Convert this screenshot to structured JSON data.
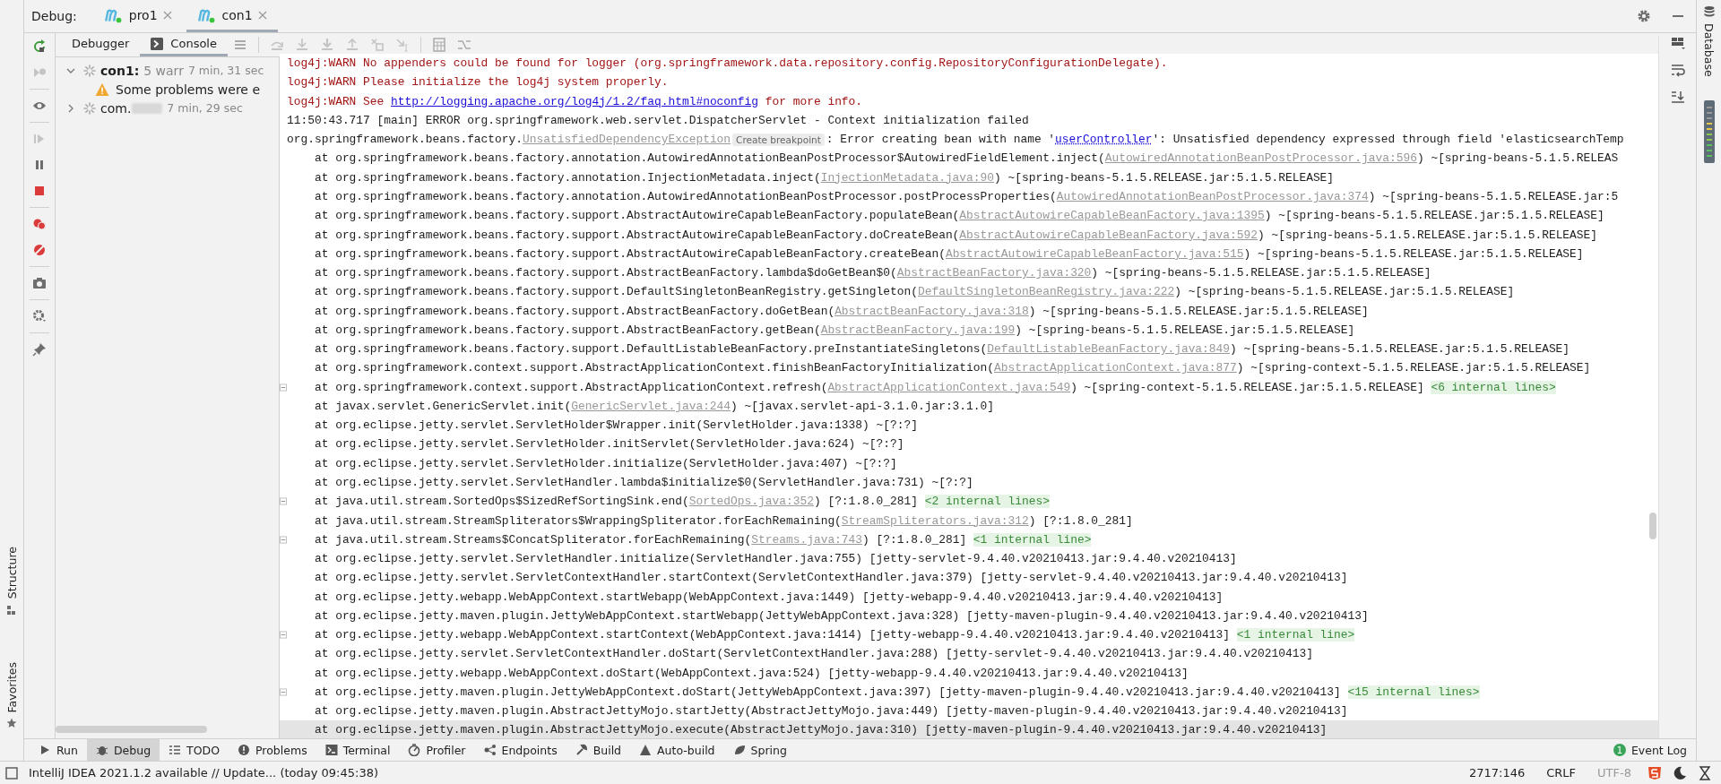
{
  "debug_bar": {
    "label": "Debug:",
    "tabs": [
      {
        "label": "pro1",
        "selected": false
      },
      {
        "label": "con1",
        "selected": true
      }
    ]
  },
  "view_tabs": [
    {
      "label": "Debugger",
      "selected": false
    },
    {
      "label": "Console",
      "selected": true
    }
  ],
  "tree": [
    {
      "label": "con1:",
      "warnings": "5 warr",
      "time": "7 min, 31 sec",
      "expanded": true,
      "children": [
        {
          "label": "Some problems were e"
        }
      ]
    },
    {
      "label": "com.",
      "time": "7 min, 29 sec",
      "expanded": false
    }
  ],
  "console": [
    {
      "kind": "warn",
      "fold_marker": false,
      "current": false,
      "parts": [
        {
          "kind": "text",
          "text": "log4j:WARN No appenders could be found for logger (org.springframework.data.repository.config.RepositoryConfigurationDelegate)."
        }
      ]
    },
    {
      "kind": "warn",
      "fold_marker": false,
      "current": false,
      "parts": [
        {
          "kind": "text",
          "text": "log4j:WARN Please initialize the log4j system properly."
        }
      ]
    },
    {
      "kind": "warn",
      "fold_marker": false,
      "current": false,
      "parts": [
        {
          "kind": "text",
          "text": "log4j:WARN See "
        },
        {
          "kind": "url",
          "text": "http://logging.apache.org/log4j/1.2/faq.html#noconfig"
        },
        {
          "kind": "text",
          "text": " for more info."
        }
      ]
    },
    {
      "kind": "message",
      "fold_marker": false,
      "current": false,
      "parts": [
        {
          "kind": "text",
          "text": "11:50:43.717 [main] ERROR org.springframework.web.servlet.DispatcherServlet - Context initialization failed"
        }
      ]
    },
    {
      "kind": "message",
      "fold_marker": false,
      "current": false,
      "parts": [
        {
          "kind": "text",
          "text": "org.springframework.beans.factory."
        },
        {
          "kind": "link",
          "text": "UnsatisfiedDependencyException"
        },
        {
          "kind": "hint",
          "text": "Create breakpoint"
        },
        {
          "kind": "text",
          "text": ": Error creating bean with name '"
        },
        {
          "kind": "ref",
          "text": "userController"
        },
        {
          "kind": "text",
          "text": "': Unsatisfied dependency expressed through field 'elasticsearchTemp"
        }
      ]
    },
    {
      "kind": "frame",
      "fold_marker": false,
      "current": false,
      "parts": [
        {
          "kind": "text",
          "text": "at org.springframework.beans.factory.annotation.AutowiredAnnotationBeanPostProcessor$AutowiredFieldElement.inject("
        },
        {
          "kind": "link",
          "text": "AutowiredAnnotationBeanPostProcessor.java:596"
        },
        {
          "kind": "text",
          "text": ") ~[spring-beans-5.1.5.RELEAS"
        }
      ]
    },
    {
      "kind": "frame",
      "fold_marker": false,
      "current": false,
      "parts": [
        {
          "kind": "text",
          "text": "at org.springframework.beans.factory.annotation.InjectionMetadata.inject("
        },
        {
          "kind": "link",
          "text": "InjectionMetadata.java:90"
        },
        {
          "kind": "text",
          "text": ") ~[spring-beans-5.1.5.RELEASE.jar:5.1.5.RELEASE]"
        }
      ]
    },
    {
      "kind": "frame",
      "fold_marker": false,
      "current": false,
      "parts": [
        {
          "kind": "text",
          "text": "at org.springframework.beans.factory.annotation.AutowiredAnnotationBeanPostProcessor.postProcessProperties("
        },
        {
          "kind": "link",
          "text": "AutowiredAnnotationBeanPostProcessor.java:374"
        },
        {
          "kind": "text",
          "text": ") ~[spring-beans-5.1.5.RELEASE.jar:5"
        }
      ]
    },
    {
      "kind": "frame",
      "fold_marker": false,
      "current": false,
      "parts": [
        {
          "kind": "text",
          "text": "at org.springframework.beans.factory.support.AbstractAutowireCapableBeanFactory.populateBean("
        },
        {
          "kind": "link",
          "text": "AbstractAutowireCapableBeanFactory.java:1395"
        },
        {
          "kind": "text",
          "text": ") ~[spring-beans-5.1.5.RELEASE.jar:5.1.5.RELEASE]"
        }
      ]
    },
    {
      "kind": "frame",
      "fold_marker": false,
      "current": false,
      "parts": [
        {
          "kind": "text",
          "text": "at org.springframework.beans.factory.support.AbstractAutowireCapableBeanFactory.doCreateBean("
        },
        {
          "kind": "link",
          "text": "AbstractAutowireCapableBeanFactory.java:592"
        },
        {
          "kind": "text",
          "text": ") ~[spring-beans-5.1.5.RELEASE.jar:5.1.5.RELEASE]"
        }
      ]
    },
    {
      "kind": "frame",
      "fold_marker": false,
      "current": false,
      "parts": [
        {
          "kind": "text",
          "text": "at org.springframework.beans.factory.support.AbstractAutowireCapableBeanFactory.createBean("
        },
        {
          "kind": "link",
          "text": "AbstractAutowireCapableBeanFactory.java:515"
        },
        {
          "kind": "text",
          "text": ") ~[spring-beans-5.1.5.RELEASE.jar:5.1.5.RELEASE]"
        }
      ]
    },
    {
      "kind": "frame",
      "fold_marker": false,
      "current": false,
      "parts": [
        {
          "kind": "text",
          "text": "at org.springframework.beans.factory.support.AbstractBeanFactory.lambda$doGetBean$0("
        },
        {
          "kind": "link",
          "text": "AbstractBeanFactory.java:320"
        },
        {
          "kind": "text",
          "text": ") ~[spring-beans-5.1.5.RELEASE.jar:5.1.5.RELEASE]"
        }
      ]
    },
    {
      "kind": "frame",
      "fold_marker": false,
      "current": false,
      "parts": [
        {
          "kind": "text",
          "text": "at org.springframework.beans.factory.support.DefaultSingletonBeanRegistry.getSingleton("
        },
        {
          "kind": "link",
          "text": "DefaultSingletonBeanRegistry.java:222"
        },
        {
          "kind": "text",
          "text": ") ~[spring-beans-5.1.5.RELEASE.jar:5.1.5.RELEASE]"
        }
      ]
    },
    {
      "kind": "frame",
      "fold_marker": false,
      "current": false,
      "parts": [
        {
          "kind": "text",
          "text": "at org.springframework.beans.factory.support.AbstractBeanFactory.doGetBean("
        },
        {
          "kind": "link",
          "text": "AbstractBeanFactory.java:318"
        },
        {
          "kind": "text",
          "text": ") ~[spring-beans-5.1.5.RELEASE.jar:5.1.5.RELEASE]"
        }
      ]
    },
    {
      "kind": "frame",
      "fold_marker": false,
      "current": false,
      "parts": [
        {
          "kind": "text",
          "text": "at org.springframework.beans.factory.support.AbstractBeanFactory.getBean("
        },
        {
          "kind": "link",
          "text": "AbstractBeanFactory.java:199"
        },
        {
          "kind": "text",
          "text": ") ~[spring-beans-5.1.5.RELEASE.jar:5.1.5.RELEASE]"
        }
      ]
    },
    {
      "kind": "frame",
      "fold_marker": false,
      "current": false,
      "parts": [
        {
          "kind": "text",
          "text": "at org.springframework.beans.factory.support.DefaultListableBeanFactory.preInstantiateSingletons("
        },
        {
          "kind": "link",
          "text": "DefaultListableBeanFactory.java:849"
        },
        {
          "kind": "text",
          "text": ") ~[spring-beans-5.1.5.RELEASE.jar:5.1.5.RELEASE]"
        }
      ]
    },
    {
      "kind": "frame",
      "fold_marker": false,
      "current": false,
      "parts": [
        {
          "kind": "text",
          "text": "at org.springframework.context.support.AbstractApplicationContext.finishBeanFactoryInitialization("
        },
        {
          "kind": "link",
          "text": "AbstractApplicationContext.java:877"
        },
        {
          "kind": "text",
          "text": ") ~[spring-context-5.1.5.RELEASE.jar:5.1.5.RELEASE]"
        }
      ]
    },
    {
      "kind": "frame",
      "fold_marker": true,
      "current": false,
      "parts": [
        {
          "kind": "text",
          "text": "at org.springframework.context.support.AbstractApplicationContext.refresh("
        },
        {
          "kind": "link",
          "text": "AbstractApplicationContext.java:549"
        },
        {
          "kind": "text",
          "text": ") ~[spring-context-5.1.5.RELEASE.jar:5.1.5.RELEASE]"
        },
        {
          "kind": "fold",
          "text": "<6 internal lines>"
        }
      ]
    },
    {
      "kind": "frame",
      "fold_marker": false,
      "current": false,
      "parts": [
        {
          "kind": "text",
          "text": "at javax.servlet.GenericServlet.init("
        },
        {
          "kind": "link",
          "text": "GenericServlet.java:244"
        },
        {
          "kind": "text",
          "text": ") ~[javax.servlet-api-3.1.0.jar:3.1.0]"
        }
      ]
    },
    {
      "kind": "frame",
      "fold_marker": false,
      "current": false,
      "parts": [
        {
          "kind": "text",
          "text": "at org.eclipse.jetty.servlet.ServletHolder$Wrapper.init(ServletHolder.java:1338) ~[?:?]"
        }
      ]
    },
    {
      "kind": "frame",
      "fold_marker": false,
      "current": false,
      "parts": [
        {
          "kind": "text",
          "text": "at org.eclipse.jetty.servlet.ServletHolder.initServlet(ServletHolder.java:624) ~[?:?]"
        }
      ]
    },
    {
      "kind": "frame",
      "fold_marker": false,
      "current": false,
      "parts": [
        {
          "kind": "text",
          "text": "at org.eclipse.jetty.servlet.ServletHolder.initialize(ServletHolder.java:407) ~[?:?]"
        }
      ]
    },
    {
      "kind": "frame",
      "fold_marker": false,
      "current": false,
      "parts": [
        {
          "kind": "text",
          "text": "at org.eclipse.jetty.servlet.ServletHandler.lambda$initialize$0(ServletHandler.java:731) ~[?:?]"
        }
      ]
    },
    {
      "kind": "frame",
      "fold_marker": true,
      "current": false,
      "parts": [
        {
          "kind": "text",
          "text": "at java.util.stream.SortedOps$SizedRefSortingSink.end("
        },
        {
          "kind": "link",
          "text": "SortedOps.java:352"
        },
        {
          "kind": "text",
          "text": ") [?:1.8.0_281]"
        },
        {
          "kind": "fold",
          "text": "<2 internal lines>"
        }
      ]
    },
    {
      "kind": "frame",
      "fold_marker": false,
      "current": false,
      "parts": [
        {
          "kind": "text",
          "text": "at java.util.stream.StreamSpliterators$WrappingSpliterator.forEachRemaining("
        },
        {
          "kind": "link",
          "text": "StreamSpliterators.java:312"
        },
        {
          "kind": "text",
          "text": ") [?:1.8.0_281]"
        }
      ]
    },
    {
      "kind": "frame",
      "fold_marker": true,
      "current": false,
      "parts": [
        {
          "kind": "text",
          "text": "at java.util.stream.Streams$ConcatSpliterator.forEachRemaining("
        },
        {
          "kind": "link",
          "text": "Streams.java:743"
        },
        {
          "kind": "text",
          "text": ") [?:1.8.0_281]"
        },
        {
          "kind": "fold",
          "text": "<1 internal line>"
        }
      ]
    },
    {
      "kind": "frame",
      "fold_marker": false,
      "current": false,
      "parts": [
        {
          "kind": "text",
          "text": "at org.eclipse.jetty.servlet.ServletHandler.initialize(ServletHandler.java:755) [jetty-servlet-9.4.40.v20210413.jar:9.4.40.v20210413]"
        }
      ]
    },
    {
      "kind": "frame",
      "fold_marker": false,
      "current": false,
      "parts": [
        {
          "kind": "text",
          "text": "at org.eclipse.jetty.servlet.ServletContextHandler.startContext(ServletContextHandler.java:379) [jetty-servlet-9.4.40.v20210413.jar:9.4.40.v20210413]"
        }
      ]
    },
    {
      "kind": "frame",
      "fold_marker": false,
      "current": false,
      "parts": [
        {
          "kind": "text",
          "text": "at org.eclipse.jetty.webapp.WebAppContext.startWebapp(WebAppContext.java:1449) [jetty-webapp-9.4.40.v20210413.jar:9.4.40.v20210413]"
        }
      ]
    },
    {
      "kind": "frame",
      "fold_marker": false,
      "current": false,
      "parts": [
        {
          "kind": "text",
          "text": "at org.eclipse.jetty.maven.plugin.JettyWebAppContext.startWebapp(JettyWebAppContext.java:328) [jetty-maven-plugin-9.4.40.v20210413.jar:9.4.40.v20210413]"
        }
      ]
    },
    {
      "kind": "frame",
      "fold_marker": true,
      "current": false,
      "parts": [
        {
          "kind": "text",
          "text": "at org.eclipse.jetty.webapp.WebAppContext.startContext(WebAppContext.java:1414) [jetty-webapp-9.4.40.v20210413.jar:9.4.40.v20210413]"
        },
        {
          "kind": "fold",
          "text": "<1 internal line>"
        }
      ]
    },
    {
      "kind": "frame",
      "fold_marker": false,
      "current": false,
      "parts": [
        {
          "kind": "text",
          "text": "at org.eclipse.jetty.servlet.ServletContextHandler.doStart(ServletContextHandler.java:288) [jetty-servlet-9.4.40.v20210413.jar:9.4.40.v20210413]"
        }
      ]
    },
    {
      "kind": "frame",
      "fold_marker": false,
      "current": false,
      "parts": [
        {
          "kind": "text",
          "text": "at org.eclipse.jetty.webapp.WebAppContext.doStart(WebAppContext.java:524) [jetty-webapp-9.4.40.v20210413.jar:9.4.40.v20210413]"
        }
      ]
    },
    {
      "kind": "frame",
      "fold_marker": true,
      "current": false,
      "parts": [
        {
          "kind": "text",
          "text": "at org.eclipse.jetty.maven.plugin.JettyWebAppContext.doStart(JettyWebAppContext.java:397) [jetty-maven-plugin-9.4.40.v20210413.jar:9.4.40.v20210413]"
        },
        {
          "kind": "fold",
          "text": "<15 internal lines>"
        }
      ]
    },
    {
      "kind": "frame",
      "fold_marker": false,
      "current": false,
      "parts": [
        {
          "kind": "text",
          "text": "at org.eclipse.jetty.maven.plugin.AbstractJettyMojo.startJetty(AbstractJettyMojo.java:449) [jetty-maven-plugin-9.4.40.v20210413.jar:9.4.40.v20210413]"
        }
      ]
    },
    {
      "kind": "frame",
      "fold_marker": false,
      "current": true,
      "parts": [
        {
          "kind": "text",
          "text": "at org.eclipse.jetty.maven.plugin.AbstractJettyMojo.execute(AbstractJettyMojo.java:310) [jetty-maven-plugin-9.4.40.v20210413.jar:9.4.40.v20210413]"
        }
      ]
    }
  ],
  "side_labels": {
    "left": [
      "Structure",
      "Favorites"
    ],
    "right": "Database"
  },
  "tool_windows": [
    {
      "label": "Run",
      "selected": false
    },
    {
      "label": "Debug",
      "selected": true
    },
    {
      "label": "TODO",
      "selected": false
    },
    {
      "label": "Problems",
      "selected": false
    },
    {
      "label": "Terminal",
      "selected": false
    },
    {
      "label": "Profiler",
      "selected": false
    },
    {
      "label": "Endpoints",
      "selected": false
    },
    {
      "label": "Build",
      "selected": false
    },
    {
      "label": "Auto-build",
      "selected": false
    },
    {
      "label": "Spring",
      "selected": false
    }
  ],
  "event_log": {
    "label": "Event Log",
    "count": "1"
  },
  "status_bar": {
    "message": "IntelliJ IDEA 2021.1.2 available // Update... (today 09:45:38)",
    "position": "2717:146",
    "line_ending": "CRLF",
    "encoding": "UTF-8"
  }
}
